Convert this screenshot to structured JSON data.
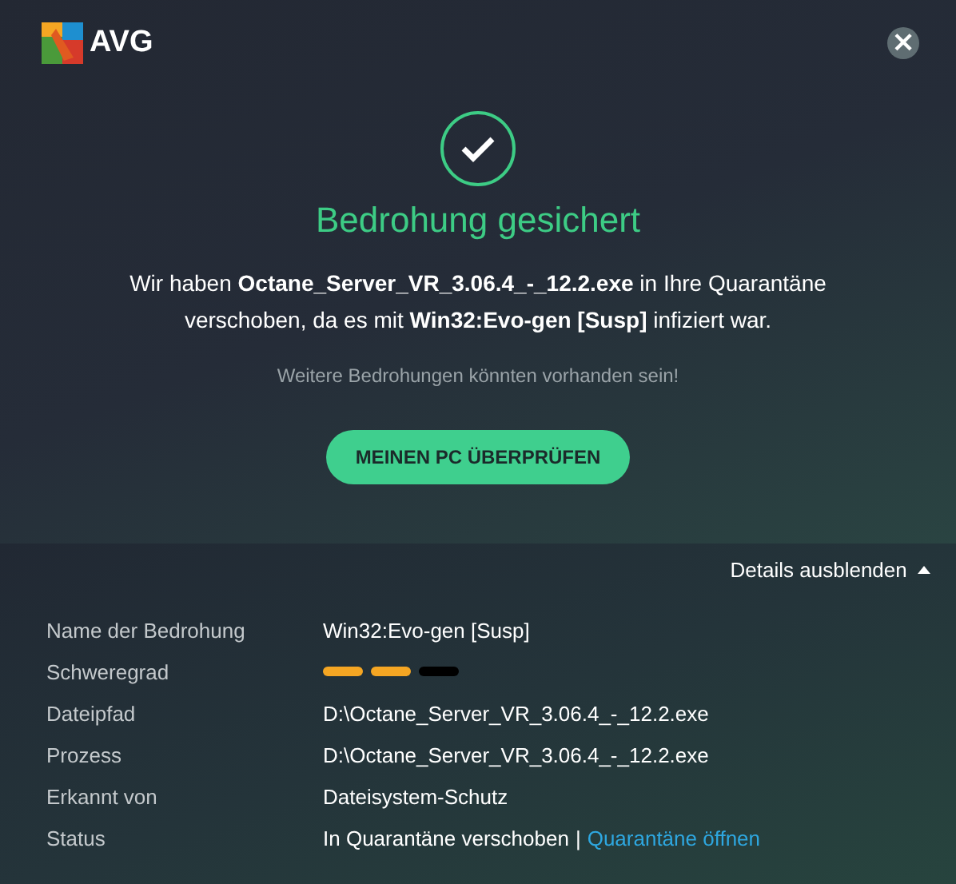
{
  "header": {
    "logo_text": "AVG",
    "close": "×"
  },
  "result": {
    "title": "Bedrohung gesichert",
    "message": "Wir haben **Octane_Server_VR_3.06.4_-_12.2.exe** in Ihre Quarantäne verschoben, da es mit **Win32:Evo-gen [Susp]** infiziert war.",
    "warning": "Weitere Bedrohungen könnten vorhanden sein!",
    "button": "MEINEN PC ÜBERPRÜFEN"
  },
  "details": {
    "toggle": {
      "label": "Details ausblenden",
      "expanded": true
    },
    "rows": [
      {
        "kind": "text",
        "label": "Name der Bedrohung",
        "value": "Win32:Evo-gen [Susp]"
      },
      {
        "kind": "severity",
        "label": "Schweregrad",
        "segments": [
          {
            "filled": true
          },
          {
            "filled": true
          },
          {
            "filled": false
          }
        ]
      },
      {
        "kind": "text",
        "label": "Dateipfad",
        "value": "D:\\Octane_Server_VR_3.06.4_-_12.2.exe"
      },
      {
        "kind": "text",
        "label": "Prozess",
        "value": "D:\\Octane_Server_VR_3.06.4_-_12.2.exe"
      },
      {
        "kind": "text",
        "label": "Erkannt von",
        "value": "Dateisystem-Schutz"
      },
      {
        "kind": "status",
        "label": "Status",
        "value": "In Quarantäne verschoben",
        "separator": "|",
        "link": "Quarantäne öffnen"
      }
    ]
  }
}
